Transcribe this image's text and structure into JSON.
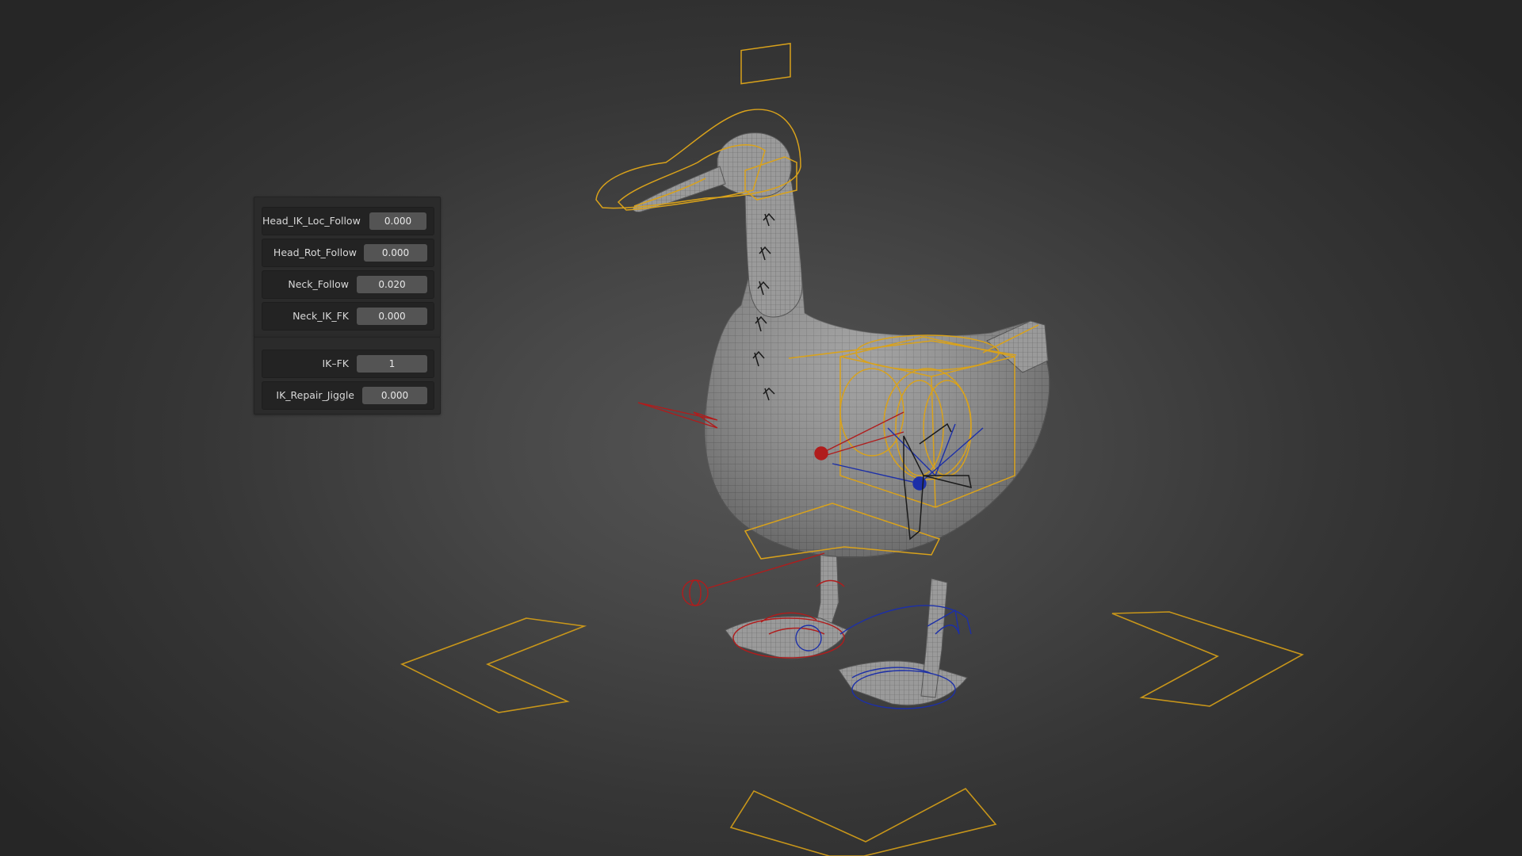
{
  "viewport": {
    "name": "3D Viewport",
    "subject": "goose-rig"
  },
  "properties": {
    "head_ik_loc_follow": {
      "label": "Head_IK_Loc_Follow",
      "value": "0.000"
    },
    "head_rot_follow": {
      "label": "Head_Rot_Follow",
      "value": "0.000"
    },
    "neck_follow": {
      "label": "Neck_Follow",
      "value": "0.020"
    },
    "neck_ik_fk": {
      "label": "Neck_IK_FK",
      "value": "0.000"
    },
    "ik_fk": {
      "label": "IK–FK",
      "value": "1"
    },
    "ik_repair_jiggle": {
      "label": "IK_Repair_Jiggle",
      "value": "0.000"
    }
  },
  "colors": {
    "selected_bone": "#d9a21b",
    "left_side_control": "#b01c1c",
    "right_side_control": "#1c2fa8",
    "field_bg": "#545454",
    "panel_bg": "#2b2b2b"
  }
}
